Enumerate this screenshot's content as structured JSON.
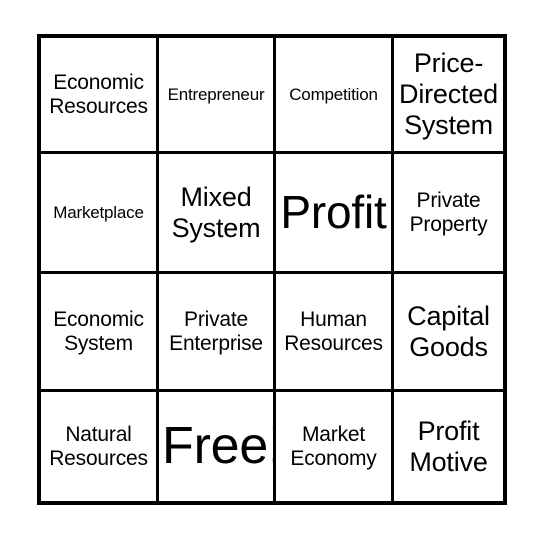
{
  "card": {
    "rows": 4,
    "columns": 4,
    "background_color": "#ffffff",
    "border_color": "#000000",
    "text_color": "#000000",
    "cells": [
      {
        "text": "Economic\nResources",
        "size": "sm"
      },
      {
        "text": "Entrepreneur",
        "size": "xs"
      },
      {
        "text": "Competition",
        "size": "xs"
      },
      {
        "text": "Price-\nDirected\nSystem",
        "size": "md"
      },
      {
        "text": "Marketplace",
        "size": "xs"
      },
      {
        "text": "Mixed\nSystem",
        "size": "md"
      },
      {
        "text": "Profit",
        "size": "lg"
      },
      {
        "text": "Private\nProperty",
        "size": "sm"
      },
      {
        "text": "Economic\nSystem",
        "size": "sm"
      },
      {
        "text": "Private\nEnterprise",
        "size": "sm"
      },
      {
        "text": "Human\nResources",
        "size": "sm"
      },
      {
        "text": "Capital\nGoods",
        "size": "md"
      },
      {
        "text": "Natural\nResources",
        "size": "sm"
      },
      {
        "text": "Free!",
        "size": "xl"
      },
      {
        "text": "Market\nEconomy",
        "size": "sm"
      },
      {
        "text": "Profit\nMotive",
        "size": "md"
      }
    ]
  }
}
